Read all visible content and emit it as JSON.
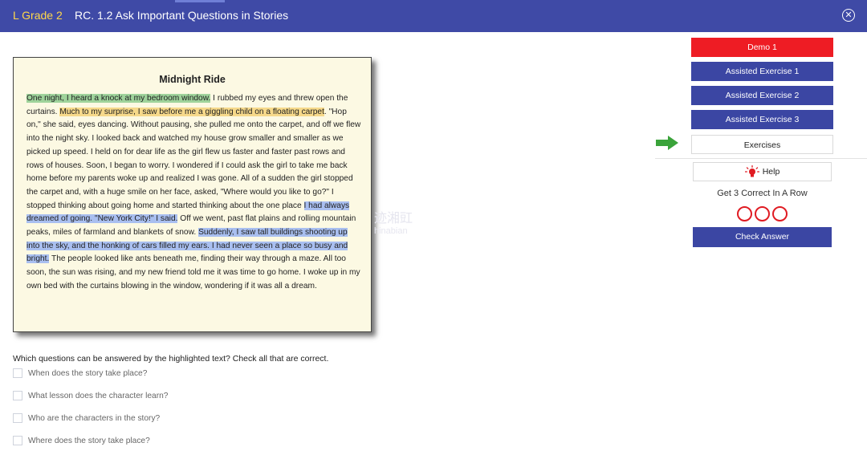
{
  "header": {
    "grade_label": "L Grade 2",
    "title": "RC. 1.2 Ask Important Questions in Stories",
    "close_icon": "close-circle-icon"
  },
  "story": {
    "title": "Midnight Ride",
    "segments": [
      {
        "text": "One night, I heard a knock at my bedroom window.",
        "highlight": "green"
      },
      {
        "text": " I rubbed my eyes and threw open the curtains. ",
        "highlight": ""
      },
      {
        "text": "Much to my surprise, I saw before me a giggling child on a floating carpet",
        "highlight": "yellow"
      },
      {
        "text": ". \"Hop on,\" she said, eyes dancing. Without pausing, she pulled me onto the carpet, and off we flew into the night sky. I looked back and watched my house grow smaller and smaller as we picked up speed. I held on for dear life as the girl flew us faster and faster past rows and rows of houses. Soon, I began to worry. I wondered if I could ask the girl to take me back home before my parents woke up and realized I was gone. All of a sudden the girl stopped the carpet and, with a huge smile on her face, asked, \"Where would you like to go?\" I stopped thinking about going home and started thinking about the one place ",
        "highlight": ""
      },
      {
        "text": "I had always dreamed of going. \"New York City!\" I said.",
        "highlight": "blue"
      },
      {
        "text": " Off we went, past flat plains and rolling mountain peaks, miles of farmland and blankets of snow. ",
        "highlight": ""
      },
      {
        "text": "Suddenly, I saw tall buildings shooting up into the sky, and the honking of cars filled my ears. I had never seen a place so busy and bright.",
        "highlight": "blue"
      },
      {
        "text": " The people looked like ants beneath me, finding their way through a maze. All too soon, the sun was rising, and my new friend told me it was time to go home. I woke up in my own bed with the curtains blowing in the window, wondering if it was all a dream.",
        "highlight": ""
      }
    ],
    "highlight_colors": {
      "green": "#9fd39b",
      "yellow": "#f6d98a",
      "blue": "#a9bff0"
    }
  },
  "question": {
    "prompt": "Which questions can be answered by the highlighted text? Check all that are correct.",
    "options": [
      "When does the story take place?",
      "What lesson does the character learn?",
      "Who are the characters in the story?",
      "Where does the story take place?"
    ]
  },
  "sidebar": {
    "demo_label": "Demo 1",
    "assisted_1_label": "Assisted Exercise 1",
    "assisted_2_label": "Assisted Exercise 2",
    "assisted_3_label": "Assisted Exercise 3",
    "exercises_label": "Exercises",
    "current_arrow_icon": "arrow-right-icon",
    "help_label": "Help",
    "help_icon": "lightbulb-icon",
    "streak_label": "Get 3 Correct In A Row",
    "streak_progress": 0,
    "streak_total": 3,
    "check_answer_label": "Check Answer"
  },
  "watermark": {
    "text": "迹湘豇",
    "sub": "hinabian"
  },
  "colors": {
    "header": "#3f4aa6",
    "grade": "#ffd84a",
    "button_blue": "#3b46a3",
    "button_red": "#ee1c24",
    "arrow": "#3aa33a",
    "circle": "#e01b22",
    "story_bg": "#fcf9e3"
  }
}
